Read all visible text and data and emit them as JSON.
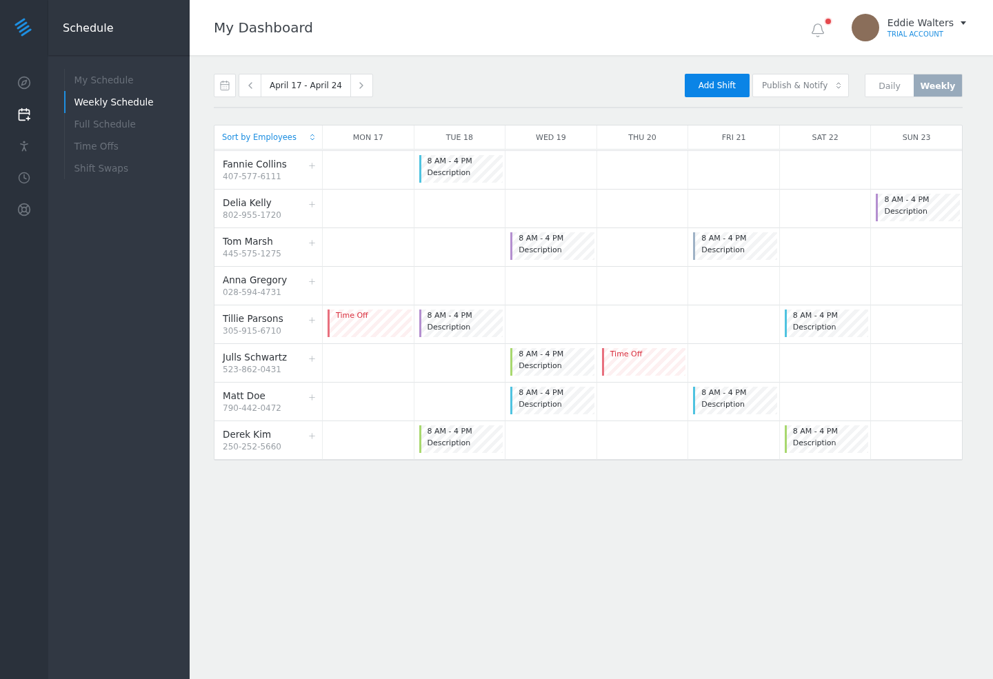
{
  "app": {
    "title": "Schedule"
  },
  "rail_icons": [
    {
      "kind": "compass",
      "selected": false
    },
    {
      "kind": "calendar",
      "selected": true
    },
    {
      "kind": "person",
      "selected": false
    },
    {
      "kind": "clock",
      "selected": false
    },
    {
      "kind": "lifebuoy",
      "selected": false
    }
  ],
  "nav": [
    {
      "label": "My Schedule",
      "selected": false
    },
    {
      "label": "Weekly Schedule",
      "selected": true
    },
    {
      "label": "Full Schedule",
      "selected": false
    },
    {
      "label": "Time Offs",
      "selected": false
    },
    {
      "label": "Shift Swaps",
      "selected": false
    }
  ],
  "header": {
    "title": "My Dashboard",
    "notification": true,
    "user": {
      "name": "Eddie Walters",
      "plan": "TRIAL ACCOUNT"
    }
  },
  "toolbar": {
    "date_range": "April 17 - April 24",
    "add_button": "Add Shift",
    "publish": "Publish & Notify",
    "views": [
      {
        "label": "Daily",
        "selected": false
      },
      {
        "label": "Weekly",
        "selected": true
      }
    ]
  },
  "table": {
    "sort_label": "Sort by Employees",
    "days": [
      "MON 17",
      "TUE 18",
      "WED 19",
      "THU 20",
      "FRI 21",
      "SAT 22",
      "SUN 23"
    ],
    "rows": [
      {
        "name": "Fannie Collins",
        "phone": "407-577-6111",
        "cells": [
          null,
          {
            "kind": "shift",
            "time": "8 AM - 4 PM",
            "description": "Description",
            "color": "#4fc3e0"
          },
          null,
          null,
          null,
          null,
          null
        ]
      },
      {
        "name": "Delia Kelly",
        "phone": "802-955-1720",
        "cells": [
          null,
          null,
          null,
          null,
          null,
          null,
          {
            "kind": "shift",
            "time": "8 AM - 4 PM",
            "description": "Description",
            "color": "#b48fd0"
          }
        ]
      },
      {
        "name": "Tom Marsh",
        "phone": "445-575-1275",
        "cells": [
          null,
          null,
          {
            "kind": "shift",
            "time": "8 AM - 4 PM",
            "description": "Description",
            "color": "#b48fd0"
          },
          null,
          {
            "kind": "shift",
            "time": "8 AM - 4 PM",
            "description": "Description",
            "color": "#9fb2c6"
          },
          null,
          null
        ]
      },
      {
        "name": "Anna Gregory",
        "phone": "028-594-4731",
        "cells": [
          null,
          null,
          null,
          null,
          null,
          null,
          null
        ]
      },
      {
        "name": "Tillie Parsons",
        "phone": "305-915-6710",
        "cells": [
          {
            "kind": "timeoff",
            "time": "Time Off",
            "color": "#e8707e"
          },
          {
            "kind": "shift",
            "time": "8 AM - 4 PM",
            "description": "Description",
            "color": "#b48fd0"
          },
          null,
          null,
          null,
          {
            "kind": "shift",
            "time": "8 AM - 4 PM",
            "description": "Description",
            "color": "#4fc3e0"
          },
          null
        ]
      },
      {
        "name": "Julls Schwartz",
        "phone": "523-862-0431",
        "cells": [
          null,
          null,
          {
            "kind": "shift",
            "time": "8 AM - 4 PM",
            "description": "Description",
            "color": "#a8d86e"
          },
          {
            "kind": "timeoff",
            "time": "Time Off",
            "color": "#e8707e"
          },
          null,
          null,
          null
        ]
      },
      {
        "name": "Matt Doe",
        "phone": "790-442-0472",
        "cells": [
          null,
          null,
          {
            "kind": "shift",
            "time": "8 AM - 4 PM",
            "description": "Description",
            "color": "#4fc3e0"
          },
          null,
          {
            "kind": "shift",
            "time": "8 AM - 4 PM",
            "description": "Description",
            "color": "#4fc3e0"
          },
          null,
          null
        ]
      },
      {
        "name": "Derek Kim",
        "phone": "250-252-5660",
        "cells": [
          null,
          {
            "kind": "shift",
            "time": "8 AM - 4 PM",
            "description": "Description",
            "color": "#a8d86e"
          },
          null,
          null,
          null,
          {
            "kind": "shift",
            "time": "8 AM - 4 PM",
            "description": "Description",
            "color": "#a8d86e"
          },
          null
        ]
      }
    ]
  }
}
